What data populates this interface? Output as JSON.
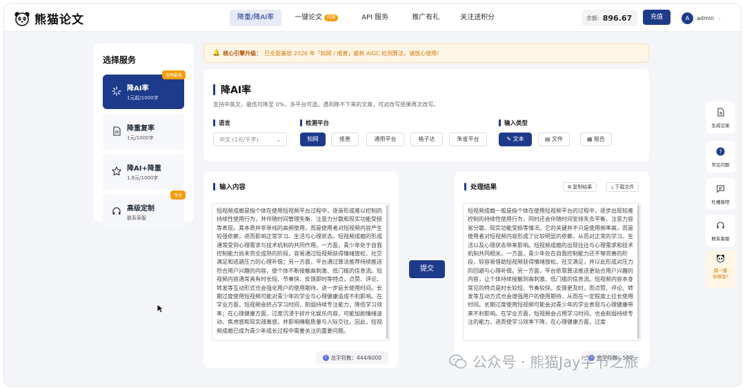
{
  "brand": {
    "title": "熊猫论文"
  },
  "nav": {
    "items": [
      {
        "label": "降重/降AI率",
        "active": true
      },
      {
        "label": "一键论文",
        "badge": "内测"
      },
      {
        "label": "API 服务"
      },
      {
        "label": "推广有礼"
      },
      {
        "label": "关注送积分"
      }
    ]
  },
  "account": {
    "balance_label": "余额:",
    "balance_value": "896.67",
    "recharge_label": "充值",
    "avatar_letter": "A",
    "username": "admin"
  },
  "sidebar": {
    "title": "选择服务",
    "items": [
      {
        "name": "降AI率",
        "price": "1元起/1000字",
        "tag": "全网最低",
        "icon": "sparkle-icon"
      },
      {
        "name": "降重复率",
        "price": "1元/1000字",
        "icon": "document-icon"
      },
      {
        "name": "降AI+降重",
        "price": "1.8元/1000字",
        "icon": "star-icon"
      },
      {
        "name": "高级定制",
        "price": "联系客服",
        "tag": "专业",
        "icon": "headset-icon"
      }
    ]
  },
  "notice": {
    "bold": "核心引擎升级：",
    "text": "已全面兼容 2026 年「知网 / 维普」最新 AIGC 检测算法，请放心使用!"
  },
  "main": {
    "title": "降AI率",
    "description": "支持中英文，最低可降至 0%，多平台可选。遇到降不下来的文章，可对改写结果再次改写。",
    "language": {
      "label": "语言",
      "value": "中文 (1元/千字)"
    },
    "platform": {
      "label": "检测平台",
      "options": [
        "知网",
        "维普",
        "通用平台",
        "格子达",
        "朱雀平台"
      ],
      "selected": "知网"
    },
    "input_type": {
      "label": "输入类型",
      "options": [
        "文本",
        "文件",
        "报告"
      ],
      "selected": "文本"
    }
  },
  "input_panel": {
    "title": "输入内容",
    "text": "短视频成瘾是指个体在使用短视频平台过程中，逐渐形成难以控制的持续性使用行为，并伴随时间管理失衡、注意力分散和现实功能受损等表现。其本质并非单纯的高频使用，而是使用者对短视频内容产生较强依赖，进而影响正常学习、生活与心理状态。短视频成瘾的形成通常受到心理需求与技术机制的共同作用。一方面，青少年处于自我控制能力尚未完全成熟的阶段，容易通过短视频获得情绪放松、社交满足和逃避压力的心理补偿；另一方面，平台通过算法推荐持续推送符合用户兴趣的内容，使个体不断接触高刺激、低门槛的信息流。短视频内容通常具有时长短、节奏快、反馈即时等特点，点赞、评论、转发等互动形式也会强化用户的使用期待，进一步延长使用时间。长期过度使用短视频可能对青少年的学业与心理健康造成不利影响。在学业方面，短视频会挤占学习时间，削弱持续专注能力，降低学习效率；在心理健康方面，过度沉浸于碎片化娱乐内容，可能加剧情绪波动、焦虑感和现实疏离感，并影响睡眠质量与人际交往。因此，短视频成瘾已成为青少年成长过程中需要关注的重要问题。",
    "count_label": "总字符数：444/6000"
  },
  "submit_label": "提交",
  "output_panel": {
    "title": "处理结果",
    "copy_label": "复制结果",
    "download_label": "下载文件",
    "text": "短视频成瘾一般是指个体在使用短视频平台的过程中，逐步出现较难控制的持续性使用行为，同时还会伴随时间安排失去平衡、注意力容易分散、现实功能受损等情况。它的关键并不只是使用频率高，而是使用者对短视频内容形成了比较明显的依赖，从而对正常的学习、生活以及心理状态带来影响。短视频成瘾的出现往往与心理需求和技术机制共同相关，一方面，青少年处在自我控制能力还不够完善的阶段，较容易借助短视频获得情绪放松、社交满足，并以此形成对压力的回避与心理补偿。另一方面，平台依靠算法推送更贴合用户兴趣的内容，让个体持续接触到高刺激、低门槛的信息流。短视频内容本身常见的特点是时长较短、节奏较快、反馈更及时，而点赞、评论、转发等互动方式也会增强用户的使用期待，从而在一定程度上拉长使用时间。长期过度使用短视频可能会对青少年的学业表现与心理健康带来不利影响。在学业方面，短视频会占用学习时间，也会削弱持续专注的能力，进而使学习效率下降，在心理健康方面，过度",
    "count_label": "总字符数：500"
  },
  "tools": [
    {
      "label": "生成记录",
      "icon": "file-icon"
    },
    {
      "label": "常见问题",
      "icon": "question-icon"
    },
    {
      "label": "吐槽我吧",
      "icon": "chat-icon"
    },
    {
      "label": "联系客服",
      "icon": "headset-icon"
    },
    {
      "label": "摸一摸\n你哪型?",
      "icon": "panda-icon"
    }
  ],
  "watermark": "公众号 · 熊猫Jay字节之旅",
  "colors": {
    "primary": "#1e3a8a",
    "accent": "#f59e0b",
    "background": "#f4f5f9"
  }
}
